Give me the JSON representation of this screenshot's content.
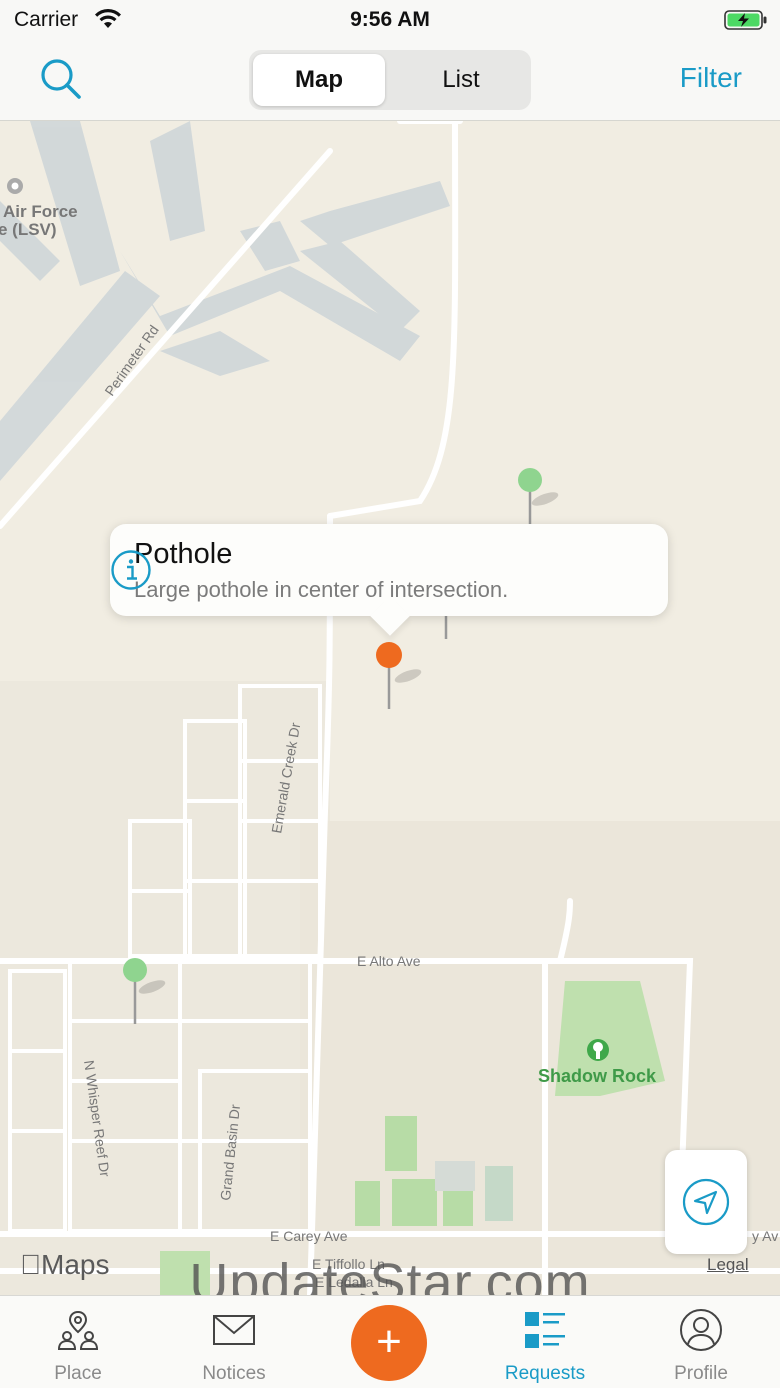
{
  "status_bar": {
    "carrier": "Carrier",
    "time": "9:56 AM"
  },
  "nav": {
    "segments": [
      "Map",
      "List"
    ],
    "selected_segment": "Map",
    "filter_label": "Filter"
  },
  "map": {
    "labels": {
      "airforce_line1": "Air Force",
      "airforce_line2": "e (LSV)",
      "perimeter": "Perimeter Rd",
      "emerald": "Emerald Creek Dr",
      "alto": "E Alto Ave",
      "whisper": "N Whisper Reef Dr",
      "grand_basin": "Grand Basin Dr",
      "shadow_rock": "Shadow Rock",
      "carey": "E Carey Ave",
      "tiffolo": "E Tiffollo Ln",
      "ledalla": "E Ledalla Ln",
      "edge_ave": "y Av"
    },
    "callout": {
      "title": "Pothole",
      "description": "Large pothole in center of intersection."
    },
    "attribution": "Maps",
    "legal": "Legal",
    "pin_colors": {
      "selected": "#ee6a1f",
      "other": "#8fd48f"
    }
  },
  "watermark": "UpdateStar.com",
  "tabs": [
    {
      "label": "Place",
      "icon": "place-icon"
    },
    {
      "label": "Notices",
      "icon": "envelope-icon"
    },
    {
      "label": "Requests",
      "icon": "requests-list-icon"
    },
    {
      "label": "Profile",
      "icon": "profile-icon"
    }
  ],
  "add_button": "+",
  "accent_color": "#1a9bc7"
}
